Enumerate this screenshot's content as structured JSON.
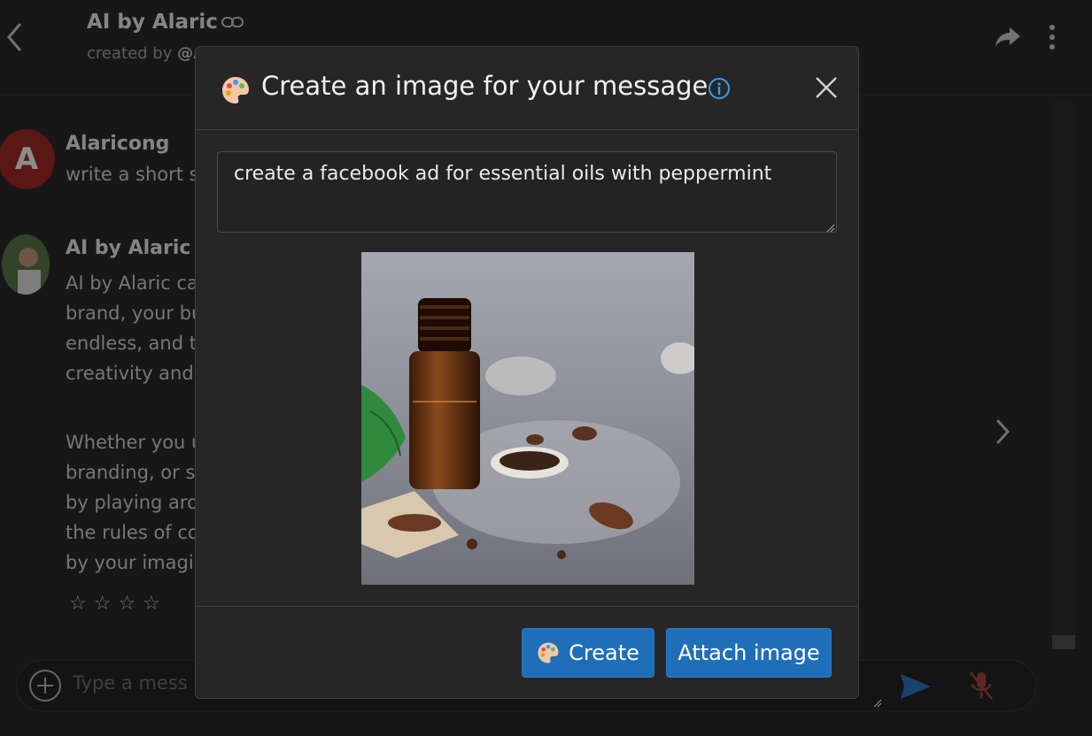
{
  "header": {
    "title": "AI by Alaric",
    "subtitle_prefix": "created by",
    "subtitle_handle": "@A"
  },
  "messages": [
    {
      "avatar_letter": "A",
      "name": "Alaricong",
      "text": "write a short s"
    },
    {
      "name": "AI by Alaric",
      "paragraph1": "AI by Alaric ca\nbrand, your bu\nendless, and t\ncreativity and",
      "paragraph2": "Whether you u\nbranding, or s\nby playing aro\nthe rules of co\nby your imagi",
      "rating_stars": "☆☆☆☆"
    }
  ],
  "composer": {
    "placeholder": "Type a messa"
  },
  "modal": {
    "title": "Create an image for your message",
    "prompt": "create a facebook ad for essential oils with peppermint",
    "create_label": "Create",
    "attach_label": "Attach image"
  },
  "colors": {
    "accent": "#1f6fb8",
    "info": "#3b9cf5",
    "avatar_a": "#a52a23"
  },
  "icons": [
    "back-icon",
    "link-icon",
    "share-icon",
    "kebab-icon",
    "palette-icon",
    "info-icon",
    "close-icon",
    "plus-icon",
    "send-icon",
    "mic-off-icon",
    "chevron-right-icon"
  ]
}
